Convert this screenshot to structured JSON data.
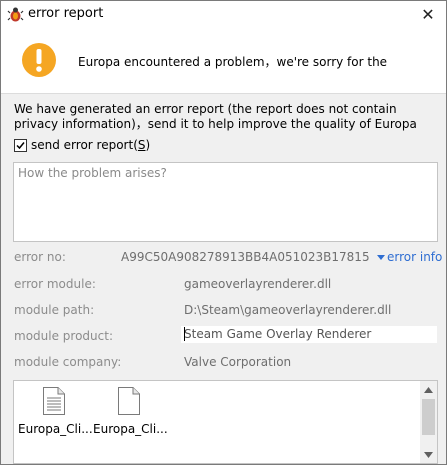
{
  "window": {
    "title": "error report",
    "close_glyph": "✕",
    "icons": {
      "app": "bug-icon",
      "close": "close-icon"
    }
  },
  "header": {
    "icon": "warning-icon",
    "message": "Europa encountered a problem，we're sorry for the"
  },
  "description": "We have generated an error report (the report does not contain privacy information)，send it to help improve the quality of Europa",
  "send_report": {
    "label_before": "send error report(",
    "label_mnemonic": "S",
    "label_after": ")",
    "checked": true
  },
  "problem_input": {
    "placeholder": "How the problem arises?",
    "value": ""
  },
  "details": {
    "error_no": {
      "label": "error no:",
      "value": "A99C50A908278913BB4A051023B17815"
    },
    "error_info_link": "error info",
    "error_module": {
      "label": "error module:",
      "value": "gameoverlayrenderer.dll"
    },
    "module_path": {
      "label": "module path:",
      "value": "D:\\Steam\\gameoverlayrenderer.dll"
    },
    "module_product": {
      "label": "module product:",
      "value": "Steam Game Overlay Renderer"
    },
    "module_company": {
      "label": "module company:",
      "value": "Valve Corporation"
    }
  },
  "attachments": {
    "files": [
      {
        "name": "Europa_Cli...",
        "icon": "text-file-icon"
      },
      {
        "name": "Europa_Cli...",
        "icon": "blank-file-icon"
      }
    ],
    "scroll_up_glyph": "▲",
    "scroll_down_glyph": "▼"
  },
  "colors": {
    "window_bg": "#f0f0f0",
    "link": "#2f6ed2",
    "warning": "#f5a623",
    "label_gray": "#8c8c8c"
  }
}
